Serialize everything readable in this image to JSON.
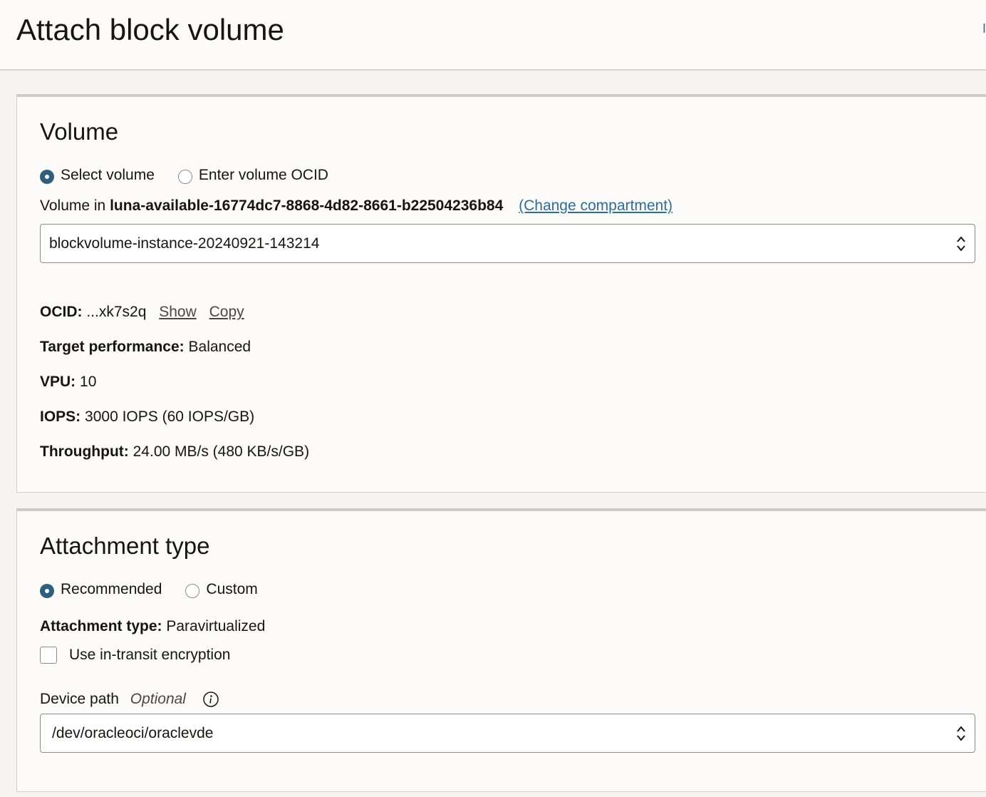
{
  "header": {
    "title": "Attach block volume",
    "edge_link": "I"
  },
  "volume_section": {
    "title": "Volume",
    "radio_options": [
      {
        "label": "Select volume",
        "checked": true
      },
      {
        "label": "Enter volume OCID",
        "checked": false
      }
    ],
    "compartment_prefix": "Volume in",
    "compartment_name": "luna-available-16774dc7-8868-4d82-8661-b22504236b84",
    "change_compartment_link": "(Change compartment)",
    "volume_select_value": "blockvolume-instance-20240921-143214",
    "details": {
      "ocid_label": "OCID:",
      "ocid_value": "...xk7s2q",
      "show_link": "Show",
      "copy_link": "Copy",
      "target_perf_label": "Target performance:",
      "target_perf_value": "Balanced",
      "vpu_label": "VPU:",
      "vpu_value": "10",
      "iops_label": "IOPS:",
      "iops_value": "3000 IOPS (60 IOPS/GB)",
      "throughput_label": "Throughput:",
      "throughput_value": "24.00 MB/s (480 KB/s/GB)"
    }
  },
  "attachment_section": {
    "title": "Attachment type",
    "radio_options": [
      {
        "label": "Recommended",
        "checked": true
      },
      {
        "label": "Custom",
        "checked": false
      }
    ],
    "type_label": "Attachment type:",
    "type_value": "Paravirtualized",
    "encryption_label": "Use in-transit encryption",
    "encryption_checked": false,
    "device_path_label": "Device path",
    "device_path_optional": "Optional",
    "device_path_value": "/dev/oracleoci/oraclevde"
  },
  "colors": {
    "accent": "#2f5f80",
    "link": "#2b6d9a",
    "background": "#f5f4f2",
    "card": "#fcfbfa"
  }
}
